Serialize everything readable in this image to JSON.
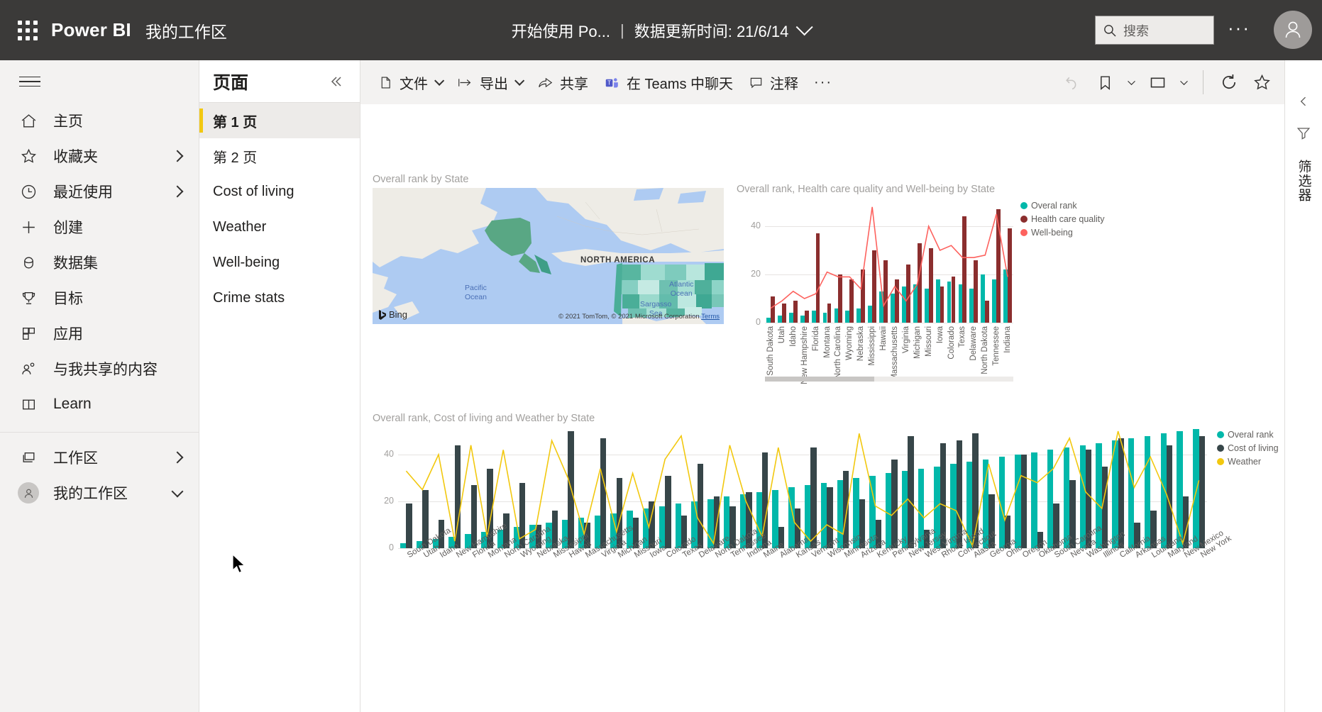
{
  "header": {
    "brand": "Power BI",
    "workspace": "我的工作区",
    "report_title": "开始使用 Po...",
    "separator": "|",
    "refresh_label": "数据更新时间: 21/6/14",
    "search_placeholder": "搜索",
    "more_label": "···"
  },
  "sidebar": {
    "items": [
      {
        "label": "主页",
        "icon": "home-icon",
        "caret": false
      },
      {
        "label": "收藏夹",
        "icon": "star-icon",
        "caret": true
      },
      {
        "label": "最近使用",
        "icon": "clock-icon",
        "caret": true
      },
      {
        "label": "创建",
        "icon": "plus-icon",
        "caret": false
      },
      {
        "label": "数据集",
        "icon": "dataset-icon",
        "caret": false
      },
      {
        "label": "目标",
        "icon": "trophy-icon",
        "caret": false
      },
      {
        "label": "应用",
        "icon": "apps-icon",
        "caret": false
      },
      {
        "label": "与我共享的内容",
        "icon": "shared-icon",
        "caret": false
      },
      {
        "label": "Learn",
        "icon": "book-icon",
        "caret": false
      }
    ],
    "footer_items": [
      {
        "label": "工作区",
        "icon": "workspaces-icon",
        "caret": true
      },
      {
        "label": "我的工作区",
        "icon": "avatar-icon",
        "caret": true
      }
    ]
  },
  "pages_panel": {
    "title": "页面",
    "collapse_icon": "double-chevron-left-icon",
    "pages": [
      {
        "label": "第 1 页",
        "active": true
      },
      {
        "label": "第 2 页",
        "active": false
      },
      {
        "label": "Cost of living",
        "active": false
      },
      {
        "label": "Weather",
        "active": false
      },
      {
        "label": "Well-being",
        "active": false
      },
      {
        "label": "Crime stats",
        "active": false
      }
    ]
  },
  "toolbar": {
    "file_label": "文件",
    "export_label": "导出",
    "share_label": "共享",
    "teams_label": "在 Teams 中聊天",
    "comment_label": "注释",
    "more_label": "···",
    "reset_icon": "undo-icon",
    "bookmark_icon": "bookmark-icon",
    "view_icon": "view-icon",
    "refresh_icon": "refresh-icon",
    "favorite_icon": "star-outline-icon"
  },
  "right_rail": {
    "expand_icon": "chevron-left-icon",
    "filter_icon": "filter-icon",
    "filter_label": "筛选器"
  },
  "map_visual": {
    "title": "Overall rank by State",
    "attribution": "© 2021 TomTom, © 2021 Microsoft Corporation",
    "terms": "Terms",
    "provider": "Bing",
    "labels": {
      "continent": "NORTH AMERICA",
      "pacific": "Pacific\nOcean",
      "atlantic": "Atlantic\nOcean",
      "sargasso": "Sargasso\nSea"
    }
  },
  "chart_data": [
    {
      "id": "chart_health",
      "type": "bar",
      "title": "Overall rank, Health care quality and Well-being by State",
      "xlabel": "",
      "ylabel": "",
      "ylim": [
        0,
        50
      ],
      "yticks": [
        0,
        20,
        40
      ],
      "grid": true,
      "legend_position": "right",
      "categories": [
        "South Dakota",
        "Utah",
        "Idaho",
        "New Hampshire",
        "Florida",
        "Montana",
        "North Carolina",
        "Wyoming",
        "Nebraska",
        "Mississippi",
        "Hawaii",
        "Massachusetts",
        "Virginia",
        "Michigan",
        "Missouri",
        "Iowa",
        "Colorado",
        "Texas",
        "Delaware",
        "North Dakota",
        "Tennessee",
        "Indiana"
      ],
      "series": [
        {
          "name": "Overal rank",
          "color": "#01B8AA",
          "type": "bar",
          "values": [
            2,
            3,
            4,
            3,
            5,
            4,
            6,
            5,
            6,
            7,
            13,
            12,
            15,
            16,
            14,
            18,
            17,
            16,
            14,
            20,
            18,
            22
          ]
        },
        {
          "name": "Health care quality",
          "color": "#8B2E2E",
          "type": "bar",
          "values": [
            11,
            8,
            9,
            5,
            37,
            8,
            20,
            18,
            22,
            30,
            26,
            18,
            24,
            33,
            31,
            15,
            19,
            44,
            26,
            9,
            47,
            39
          ]
        },
        {
          "name": "Well-being",
          "color": "#FD625E",
          "type": "line",
          "values": [
            6,
            9,
            13,
            10,
            12,
            21,
            19,
            19,
            14,
            48,
            7,
            15,
            9,
            16,
            40,
            30,
            32,
            27,
            27,
            28,
            45,
            19
          ]
        }
      ],
      "scrollbar": {
        "thumb_start": 0.0,
        "thumb_width": 0.44
      }
    },
    {
      "id": "chart_cost_weather",
      "type": "bar",
      "title": "Overall rank, Cost of living and Weather by State",
      "xlabel": "",
      "ylabel": "",
      "ylim": [
        0,
        50
      ],
      "yticks": [
        0,
        20,
        40
      ],
      "grid": true,
      "legend_position": "right",
      "categories": [
        "South Dakota",
        "Utah",
        "Idaho",
        "New Hampshire",
        "Florida",
        "Montana",
        "North Carolina",
        "Wyoming",
        "Nebraska",
        "Mississippi",
        "Hawaii",
        "Massachusetts",
        "Virginia",
        "Michigan",
        "Missouri",
        "Iowa",
        "Colorado",
        "Texas",
        "Delaware",
        "North Dakota",
        "Tennessee",
        "Indiana",
        "Maine",
        "Alabama",
        "Kansas",
        "Vermont",
        "Wisconsin",
        "Minnesota",
        "Arizona",
        "Kentucky",
        "Pennsylvania",
        "New Jersey",
        "West Virginia",
        "Rhode Island",
        "Connecticut",
        "Alaska",
        "Georgia",
        "Ohio",
        "Oregon",
        "Oklahoma",
        "South Carolina",
        "Nevada",
        "Washington",
        "Illinois",
        "California",
        "Arkansas",
        "Louisiana",
        "Maryland",
        "New Mexico",
        "New York"
      ],
      "series": [
        {
          "name": "Overal rank",
          "color": "#01B8AA",
          "type": "bar",
          "values": [
            2,
            3,
            4,
            5,
            6,
            7,
            8,
            9,
            10,
            11,
            12,
            13,
            14,
            15,
            16,
            17,
            18,
            19,
            20,
            21,
            22,
            23,
            24,
            25,
            26,
            27,
            28,
            29,
            30,
            31,
            32,
            33,
            34,
            35,
            36,
            37,
            38,
            39,
            40,
            41,
            42,
            43,
            44,
            45,
            46,
            47,
            48,
            49,
            50,
            51
          ]
        },
        {
          "name": "Cost of living",
          "color": "#374649",
          "type": "bar",
          "values": [
            19,
            25,
            12,
            44,
            27,
            34,
            15,
            28,
            10,
            16,
            50,
            11,
            47,
            30,
            13,
            20,
            31,
            14,
            36,
            22,
            18,
            24,
            41,
            9,
            17,
            43,
            26,
            33,
            21,
            12,
            38,
            48,
            8,
            45,
            46,
            49,
            23,
            14,
            40,
            7,
            19,
            29,
            42,
            35,
            47,
            11,
            16,
            44,
            22,
            48
          ]
        },
        {
          "name": "Weather",
          "color": "#F2C80F",
          "type": "line",
          "values": [
            33,
            25,
            40,
            3,
            44,
            5,
            42,
            4,
            8,
            46,
            30,
            6,
            34,
            7,
            32,
            9,
            38,
            48,
            13,
            2,
            44,
            20,
            5,
            43,
            11,
            3,
            10,
            6,
            49,
            18,
            14,
            21,
            13,
            19,
            16,
            1,
            36,
            12,
            31,
            28,
            34,
            47,
            24,
            17,
            50,
            26,
            39,
            23,
            2,
            29
          ]
        }
      ]
    }
  ]
}
